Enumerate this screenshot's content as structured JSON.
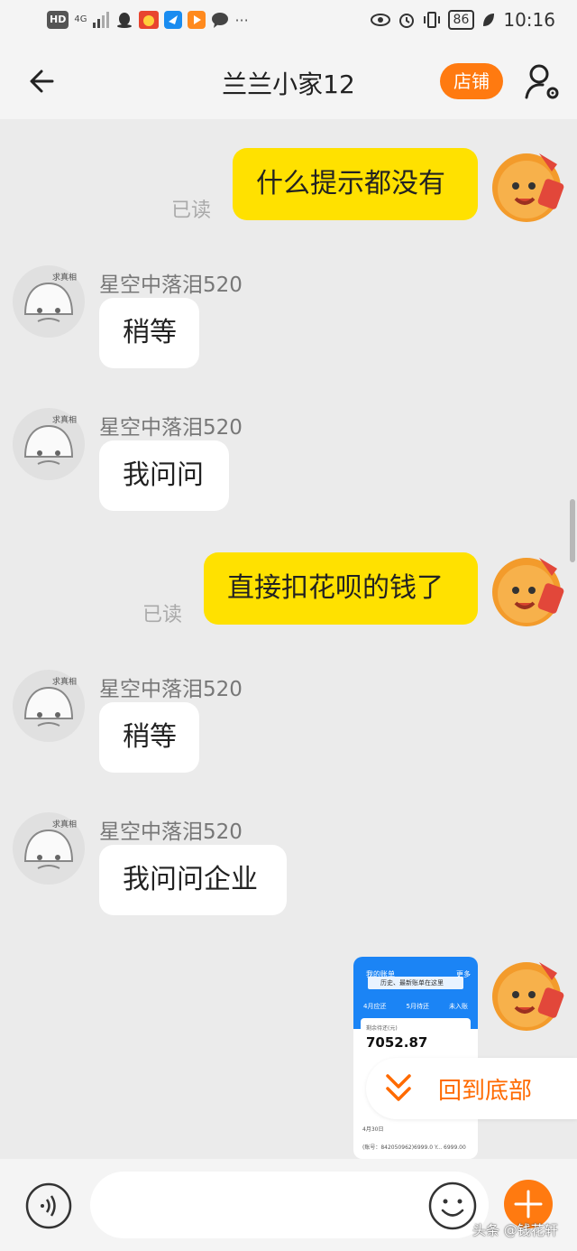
{
  "status_bar": {
    "left_badges": [
      "HD",
      "4G"
    ],
    "notification_icons": [
      "qq-icon",
      "game-icon",
      "alipay-icon",
      "video-icon",
      "chat-icon"
    ],
    "more": "···",
    "battery": "86",
    "time": "10:16"
  },
  "header": {
    "title": "兰兰小家12",
    "shop_label": "店铺"
  },
  "messages": [
    {
      "side": "right",
      "text": "什么提示都没有",
      "read": "已读"
    },
    {
      "side": "left",
      "sender": "星空中落泪520",
      "text": "稍等"
    },
    {
      "side": "left",
      "sender": "星空中落泪520",
      "text": "我问问"
    },
    {
      "side": "right",
      "text": "直接扣花呗的钱了",
      "read": "已读"
    },
    {
      "side": "left",
      "sender": "星空中落泪520",
      "text": "稍等"
    },
    {
      "side": "left",
      "sender": "星空中落泪520",
      "text": "我问问企业"
    }
  ],
  "avatar_badge": "求真相",
  "image_message": {
    "title": "我的账单",
    "more": "更多",
    "notice": "历史、最新账单在这里",
    "tabs": [
      "4月应还",
      "5月待还",
      "未入账"
    ],
    "card_label": "剩余待还(元)",
    "amount": "7052.87",
    "month_label": "4月30日",
    "row_text": "(账号：842050962)6999.0 Y...",
    "row_amount": "6999.00"
  },
  "back_to_bottom": {
    "label": "回到底部"
  },
  "input_bar": {
    "placeholder": ""
  },
  "watermark": "头条 @钱花轩",
  "colors": {
    "accent": "#ff7a10",
    "bubble_self": "#ffe100",
    "bubble_other": "#ffffff",
    "background": "#ebebeb"
  }
}
